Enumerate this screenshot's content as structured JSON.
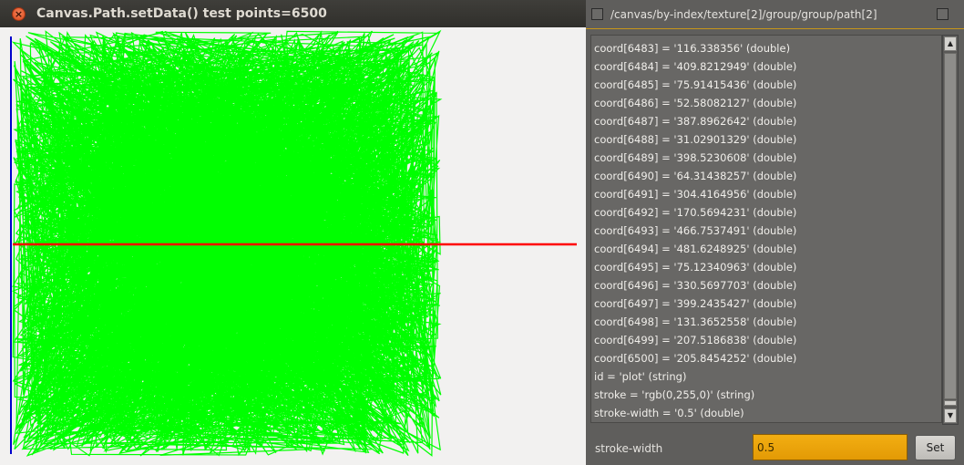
{
  "left_window": {
    "title": "Canvas.Path.setData() test points=6500",
    "close_glyph": "×"
  },
  "plot": {
    "stroke": "#00ff00",
    "stroke_width": 0.5,
    "point_count": 6500,
    "hline_color": "#ff0000",
    "vline_color": "#0000cc"
  },
  "right_window": {
    "path": "/canvas/by-index/texture[2]/group/group/path[2]",
    "properties": [
      "coord[6483] = '116.338356' (double)",
      "coord[6484] = '409.8212949' (double)",
      "coord[6485] = '75.91415436' (double)",
      "coord[6486] = '52.58082127' (double)",
      "coord[6487] = '387.8962642' (double)",
      "coord[6488] = '31.02901329' (double)",
      "coord[6489] = '398.5230608' (double)",
      "coord[6490] = '64.31438257' (double)",
      "coord[6491] = '304.4164956' (double)",
      "coord[6492] = '170.5694231' (double)",
      "coord[6493] = '466.7537491' (double)",
      "coord[6494] = '481.6248925' (double)",
      "coord[6495] = '75.12340963' (double)",
      "coord[6496] = '330.5697703' (double)",
      "coord[6497] = '399.2435427' (double)",
      "coord[6498] = '131.3652558' (double)",
      "coord[6499] = '207.5186838' (double)",
      "coord[6500] = '205.8454252' (double)",
      "id = 'plot' (string)",
      "stroke = 'rgb(0,255,0)' (string)",
      "stroke-width = '0.5' (double)"
    ],
    "edit_label": "stroke-width",
    "edit_value": "0.5",
    "set_button": "Set",
    "scroll_up_glyph": "▲",
    "scroll_down_glyph": "▼"
  }
}
